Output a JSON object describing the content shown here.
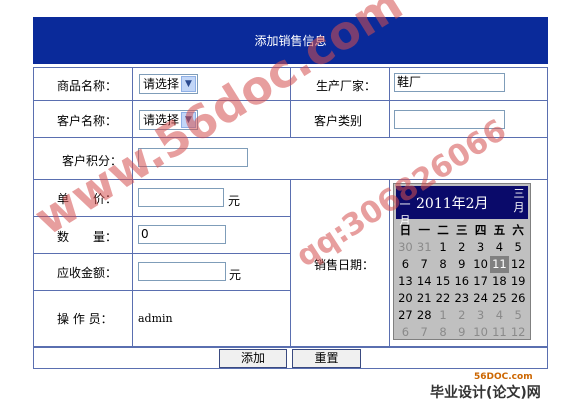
{
  "header": {
    "title": "添加销售信息"
  },
  "form": {
    "product_label": "商品名称：",
    "product_value": "请选择",
    "manufacturer_label": "生产厂家：",
    "manufacturer_value": "鞋厂",
    "customer_label": "客户名称：",
    "customer_value": "请选择",
    "customer_type_label": "客户类别",
    "points_label": "客户积分：",
    "price_label": "单　　价：",
    "price_unit": "元",
    "qty_label": "数　　量：",
    "qty_value": "0",
    "amount_label": "应收金额：",
    "amount_unit": "元",
    "operator_label": "操 作 员：",
    "operator_value": "admin",
    "date_label": "销售日期："
  },
  "calendar": {
    "title": "2011年2月",
    "prev_label": "一月",
    "next_label": "三月",
    "weekdays": [
      "日",
      "一",
      "二",
      "三",
      "四",
      "五",
      "六"
    ],
    "weeks": [
      [
        "30",
        "31",
        "1",
        "2",
        "3",
        "4",
        "5"
      ],
      [
        "6",
        "7",
        "8",
        "9",
        "10",
        "11",
        "12"
      ],
      [
        "13",
        "14",
        "15",
        "16",
        "17",
        "18",
        "19"
      ],
      [
        "20",
        "21",
        "22",
        "23",
        "24",
        "25",
        "26"
      ],
      [
        "27",
        "28",
        "1",
        "2",
        "3",
        "4",
        "5"
      ],
      [
        "6",
        "7",
        "8",
        "9",
        "10",
        "11",
        "12"
      ]
    ],
    "today": "11"
  },
  "buttons": {
    "add": "添加",
    "reset": "重置"
  },
  "watermarks": {
    "site": "www.56doc.com",
    "qq": "qq:306826066"
  },
  "footer": {
    "brand": "毕业设计(论文)网",
    "site": "56DOC.com"
  }
}
